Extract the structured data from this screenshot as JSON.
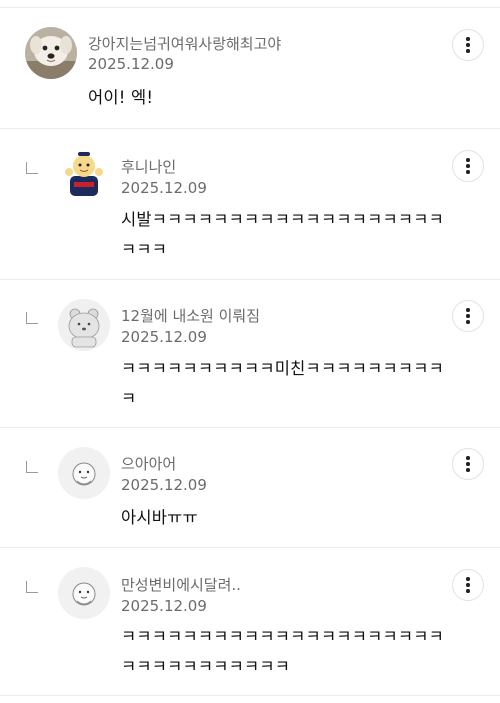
{
  "comments": [
    {
      "nickname": "강아지는넘귀여워사랑해최고야",
      "date": "2025.12.09",
      "text": "어이! 엑!",
      "avatar": "dog-photo-avatar",
      "is_reply": false
    },
    {
      "nickname": "후니나인",
      "date": "2025.12.09",
      "text": "시발ㅋㅋㅋㅋㅋㅋㅋㅋㅋㅋㅋㅋㅋㅋㅋㅋㅋㅋㅋㅋㅋㅋ",
      "avatar": "baseball-mascot-avatar",
      "is_reply": true
    },
    {
      "nickname": "12월에 내소원 이뤄짐",
      "date": "2025.12.09",
      "text": "ㅋㅋㅋㅋㅋㅋㅋㅋㅋㅋ미친ㅋㅋㅋㅋㅋㅋㅋㅋㅋㅋ",
      "avatar": "bear-avatar",
      "is_reply": true
    },
    {
      "nickname": "으아아어",
      "date": "2025.12.09",
      "text": "아시바ㅠㅠ",
      "avatar": "blob-character-avatar",
      "is_reply": true
    },
    {
      "nickname": "만성변비에시달려..",
      "date": "2025.12.09",
      "text": "ㅋㅋㅋㅋㅋㅋㅋㅋㅋㅋㅋㅋㅋㅋㅋㅋㅋㅋㅋㅋㅋㅋㅋㅋㅋㅋㅋㅋㅋㅋㅋㅋ",
      "avatar": "blob-character-avatar",
      "is_reply": true
    }
  ],
  "more_icon": "more-vertical-icon",
  "reply_icon": "reply-corner-icon"
}
